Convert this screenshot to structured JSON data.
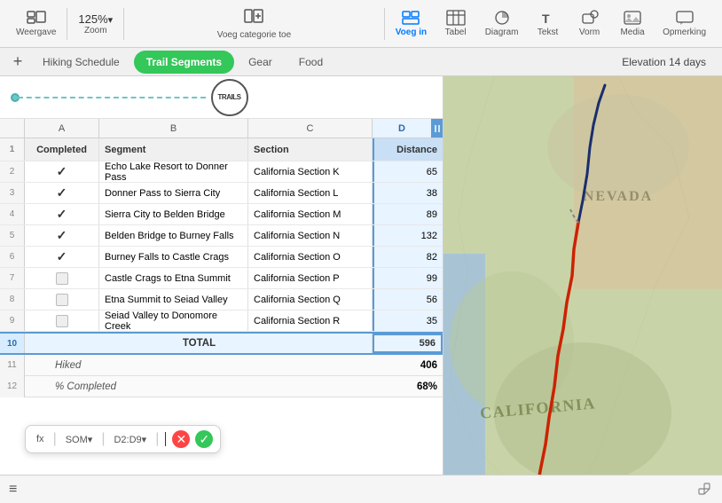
{
  "toolbar": {
    "view_label": "Weergave",
    "zoom_value": "125%",
    "zoom_chevron": "▾",
    "zoom_label": "Zoom",
    "add_category_label": "Voeg categorie toe",
    "voeg_in_label": "Voeg in",
    "tabel_label": "Tabel",
    "diagram_label": "Diagram",
    "tekst_label": "Tekst",
    "vorm_label": "Vorm",
    "media_label": "Media",
    "opmerking_label": "Opmerking"
  },
  "tabs": {
    "add_label": "+",
    "hiking_schedule_label": "Hiking Schedule",
    "trail_segments_label": "Trail Segments",
    "gear_label": "Gear",
    "food_label": "Food",
    "elevation_label": "Elevation 14 days"
  },
  "spreadsheet": {
    "columns": [
      "",
      "A",
      "B",
      "C",
      "D"
    ],
    "headers": [
      "Completed",
      "Segment",
      "Section",
      "Distance"
    ],
    "rows": [
      {
        "num": "2",
        "completed": "✓",
        "segment": "Echo Lake Resort to Donner Pass",
        "section": "California Section K",
        "distance": "65"
      },
      {
        "num": "3",
        "completed": "✓",
        "segment": "Donner Pass to Sierra City",
        "section": "California Section L",
        "distance": "38"
      },
      {
        "num": "4",
        "completed": "✓",
        "segment": "Sierra City to Belden Bridge",
        "section": "California Section M",
        "distance": "89"
      },
      {
        "num": "5",
        "completed": "✓",
        "segment": "Belden Bridge to Burney Falls",
        "section": "California Section N",
        "distance": "132"
      },
      {
        "num": "6",
        "completed": "✓",
        "segment": "Burney Falls to Castle Crags",
        "section": "California Section O",
        "distance": "82"
      },
      {
        "num": "7",
        "completed": "",
        "segment": "Castle Crags to Etna Summit",
        "section": "California Section P",
        "distance": "99"
      },
      {
        "num": "8",
        "completed": "",
        "segment": "Etna Summit to Seiad Valley",
        "section": "California Section Q",
        "distance": "56"
      },
      {
        "num": "9",
        "completed": "",
        "segment": "Seiad Valley to Donomore Creek",
        "section": "California Section R",
        "distance": "35"
      }
    ],
    "total_row": {
      "num": "10",
      "label": "TOTAL",
      "value": "596"
    },
    "hiked_row": {
      "num": "11",
      "label": "Hiked",
      "value": "406"
    },
    "pct_row": {
      "num": "12",
      "label": "% Completed",
      "value": "68%"
    }
  },
  "formula_bar": {
    "fx_label": "fx",
    "func_label": "SOM",
    "range_label": "D2:D9",
    "cursor": "|"
  },
  "map": {
    "nevada_label": "NEVADA",
    "california_label": "CALIFORNIA"
  },
  "bottom": {
    "hamburger": "≡"
  }
}
